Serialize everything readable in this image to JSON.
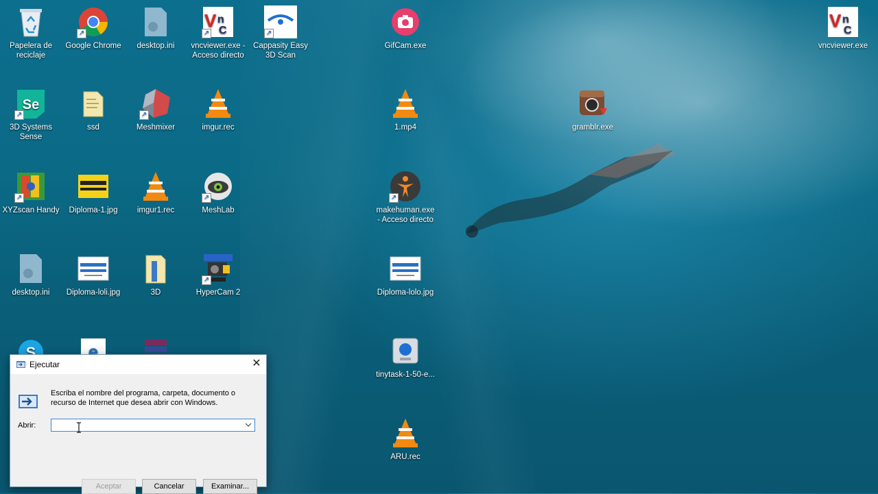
{
  "desktop": {
    "icons": [
      {
        "label": "Papelera de reciclaje",
        "icon": "recycle-bin-icon"
      },
      {
        "label": "Google Chrome",
        "icon": "chrome-icon"
      },
      {
        "label": "desktop.ini",
        "icon": "ini-file-icon"
      },
      {
        "label": "vncviewer.exe - Acceso directo",
        "icon": "vnc-icon"
      },
      {
        "label": "Cappasity Easy 3D Scan",
        "icon": "cappasity-icon"
      },
      {
        "label": "GifCam.exe",
        "icon": "gifcam-icon"
      },
      {
        "label": "vncviewer.exe",
        "icon": "vnc-icon"
      },
      {
        "label": "3D Systems Sense",
        "icon": "sense-icon"
      },
      {
        "label": "ssd",
        "icon": "folder-icon"
      },
      {
        "label": "Meshmixer",
        "icon": "meshmixer-icon"
      },
      {
        "label": "imgur.rec",
        "icon": "vlc-icon"
      },
      {
        "label": "1.mp4",
        "icon": "vlc-icon"
      },
      {
        "label": "gramblr.exe",
        "icon": "gramblr-icon"
      },
      {
        "label": "XYZscan Handy",
        "icon": "xyzscan-icon"
      },
      {
        "label": "Diploma-1.jpg",
        "icon": "image-icon"
      },
      {
        "label": "imgur1.rec",
        "icon": "vlc-icon"
      },
      {
        "label": "MeshLab",
        "icon": "meshlab-icon"
      },
      {
        "label": "makehuman.exe - Acceso directo",
        "icon": "makehuman-icon"
      },
      {
        "label": "desktop.ini",
        "icon": "ini-file-icon"
      },
      {
        "label": "Diploma-loli.jpg",
        "icon": "image-icon"
      },
      {
        "label": "3D",
        "icon": "folder-icon"
      },
      {
        "label": "HyperCam 2",
        "icon": "hypercam-icon"
      },
      {
        "label": "Diploma-lolo.jpg",
        "icon": "image-icon"
      },
      {
        "label": "tinytask-1-50-e...",
        "icon": "tinytask-icon"
      },
      {
        "label": "ARU.rec",
        "icon": "vlc-icon"
      }
    ]
  },
  "run_dialog": {
    "title": "Ejecutar",
    "description": "Escriba el nombre del programa, carpeta, documento o recurso de Internet que desea abrir con Windows.",
    "open_label": "Abrir:",
    "input_value": "",
    "ok_label": "Aceptar",
    "cancel_label": "Cancelar",
    "browse_label": "Examinar...",
    "accent": "#3c86d8"
  }
}
